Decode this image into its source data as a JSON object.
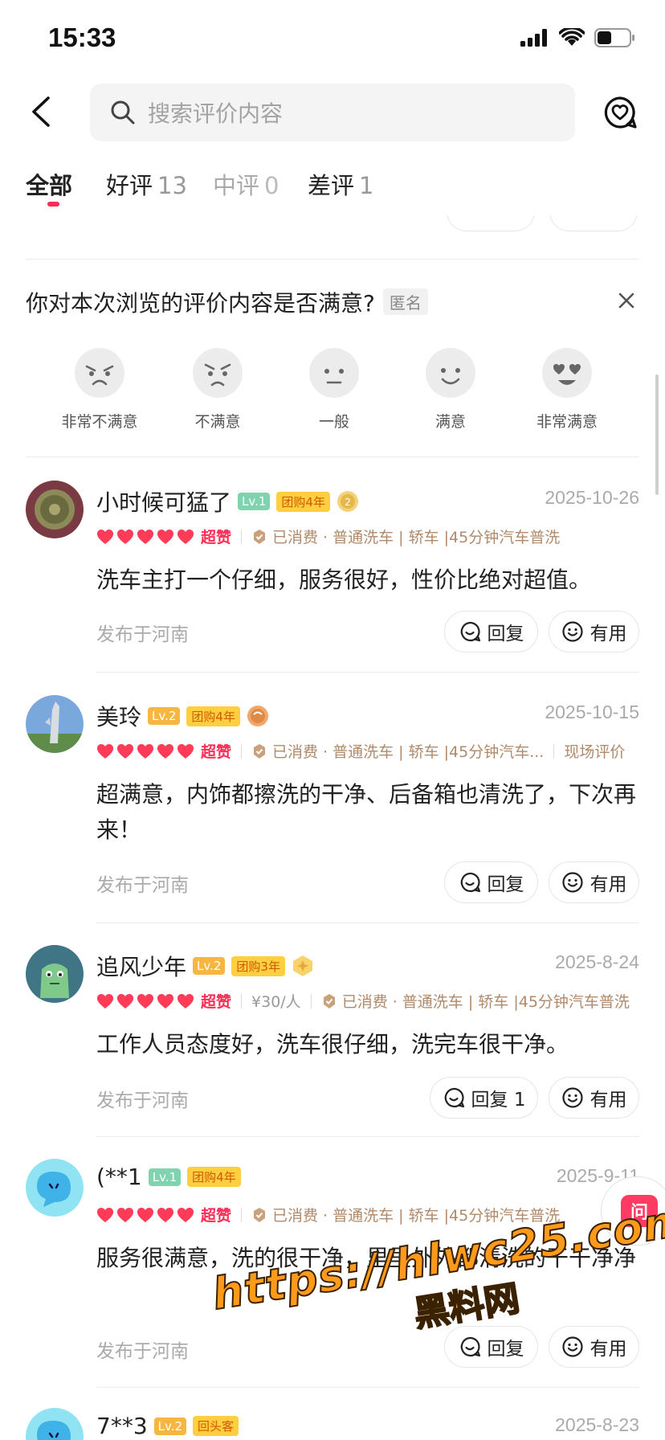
{
  "status_bar": {
    "time": "15:33"
  },
  "search": {
    "placeholder": "搜索评价内容"
  },
  "tabs": [
    {
      "label": "全部",
      "count": ""
    },
    {
      "label": "好评",
      "count": "13"
    },
    {
      "label": "中评",
      "count": "0"
    },
    {
      "label": "差评",
      "count": "1"
    }
  ],
  "survey": {
    "question": "你对本次浏览的评价内容是否满意?",
    "anon_badge": "匿名",
    "options": [
      "非常不满意",
      "不满意",
      "一般",
      "满意",
      "非常满意"
    ]
  },
  "reviews": [
    {
      "username": "小时候可猛了",
      "level": "Lv.1",
      "tag": "团购4年",
      "date": "2025-10-26",
      "rating_label": "超赞",
      "consumed": "已消费 · 普通洗车 | 轿车 |45分钟汽车普洗",
      "text": "洗车主打一个仔细，服务很好，性价比绝对超值。",
      "location": "发布于河南",
      "reply_label": "回复",
      "useful_label": "有用"
    },
    {
      "username": "美玲",
      "level": "Lv.2",
      "tag": "团购4年",
      "date": "2025-10-15",
      "rating_label": "超赞",
      "consumed": "已消费 · 普通洗车 | 轿车 |45分钟汽车...",
      "extra": "现场评价",
      "text": "超满意，内饰都擦洗的干净、后备箱也清洗了，下次再来！",
      "location": "发布于河南",
      "reply_label": "回复",
      "useful_label": "有用"
    },
    {
      "username": "追风少年",
      "level": "Lv.2",
      "tag": "团购3年",
      "date": "2025-8-24",
      "rating_label": "超赞",
      "price": "¥30/人",
      "consumed": "已消费 · 普通洗车 | 轿车 |45分钟汽车普洗",
      "text": "工作人员态度好，洗车很仔细，洗完车很干净。",
      "location": "发布于河南",
      "reply_label": "回复 1",
      "useful_label": "有用"
    },
    {
      "username": "(**1",
      "level": "Lv.1",
      "tag": "团购4年",
      "date": "2025-9-11",
      "rating_label": "超赞",
      "consumed": "已消费 · 普通洗车 | 轿车 |45分钟汽车普洗",
      "text": "服务很满意，洗的很干净，里里外外都清洗的干干净净",
      "location": "发布于河南",
      "reply_label": "回复",
      "useful_label": "有用"
    },
    {
      "username": "7**3",
      "level": "Lv.2",
      "tag": "回头客",
      "date": "2025-8-23"
    }
  ],
  "float_button": {
    "label": "问"
  },
  "watermark": {
    "line1": "https://hlwc25.com",
    "line2": "黑料网"
  },
  "colors": {
    "accent": "#ff2d55",
    "consumed_text": "#b08a6a",
    "muted": "#aaaaaa"
  }
}
